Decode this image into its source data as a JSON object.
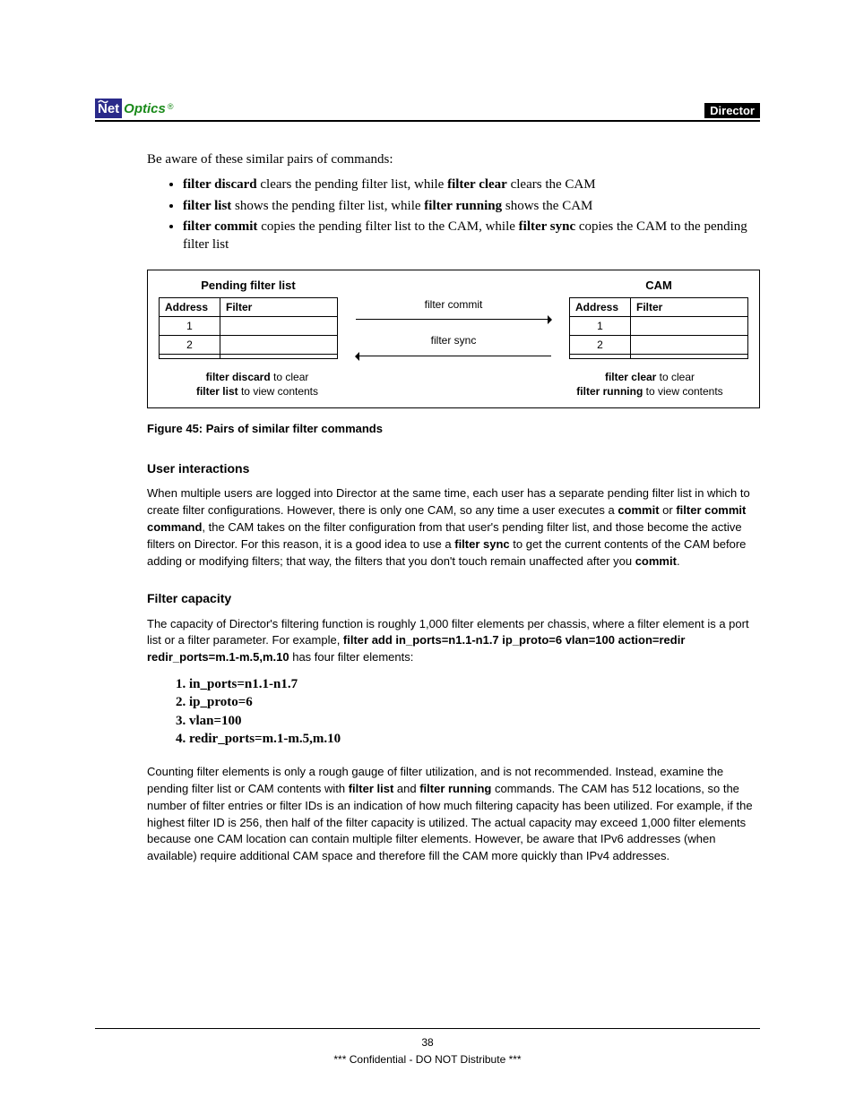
{
  "header": {
    "logo_net": "Net",
    "logo_optics": "Optics",
    "logo_reg": "®",
    "badge": "Director"
  },
  "intro": "Be aware of these similar pairs of commands:",
  "bullets": [
    {
      "b1": "filter discard",
      "t1": " clears the pending filter list, while ",
      "b2": "filter clear",
      "t2": " clears the CAM"
    },
    {
      "b1": "filter list",
      "t1": " shows the pending filter list, while ",
      "b2": "filter running",
      "t2": " shows the CAM"
    },
    {
      "b1": "filter commit",
      "t1": " copies the pending filter list to the CAM, while ",
      "b2": "filter sync",
      "t2": " copies the CAM to the pending filter list"
    }
  ],
  "figure": {
    "left_title": "Pending filter list",
    "right_title": "CAM",
    "cols": [
      "Address",
      "Filter"
    ],
    "left_rows": [
      "1",
      "2",
      ""
    ],
    "right_rows": [
      "1",
      "2",
      ""
    ],
    "arrow1": "filter commit",
    "arrow2": "filter sync",
    "under_left_b1": "filter discard",
    "under_left_t1": " to clear",
    "under_left_b2": "filter list",
    "under_left_t2": " to view contents",
    "under_right_b1": "filter clear",
    "under_right_t1": " to clear",
    "under_right_b2": "filter running",
    "under_right_t2": " to view contents"
  },
  "fig_caption": "Figure 45: Pairs of similar filter commands",
  "sec1_h": "User interactions",
  "sec1_p": {
    "t1": "When multiple users are logged into Director at the same time, each user has a separate pending filter list in which to create filter configurations. However, there is only one CAM, so any time a user executes a ",
    "b1": "commit",
    "t2": " or ",
    "b2": "filter commit command",
    "t3": ", the CAM takes on the filter configuration from that user's pending filter list, and those become the active filters on Director. For this reason, it is a good idea to use a ",
    "b3": "filter sync",
    "t4": " to get the current contents of the CAM before adding or modifying filters; that way, the filters that you don't touch remain unaffected after you ",
    "b4": "commit",
    "t5": "."
  },
  "sec2_h": "Filter capacity",
  "sec2_p1": {
    "t1": "The capacity of Director's filtering function is roughly 1,000 filter elements per chassis, where a filter element is a port list or a filter parameter. For example, ",
    "b1": "filter add in_ports=n1.1-n1.7 ip_proto=6 vlan=100 action=redir redir_ports=m.1-m.5,m.10",
    "t2": " has four filter elements:"
  },
  "numlist": [
    "1. in_ports=n1.1-n1.7",
    "2. ip_proto=6",
    "3. vlan=100",
    "4. redir_ports=m.1-m.5,m.10"
  ],
  "sec2_p2": {
    "t1": "Counting filter elements is only a rough gauge of filter utilization, and is not recommended. Instead, examine the pending filter list or CAM contents with ",
    "b1": "filter list",
    "t2": " and ",
    "b2": "filter running",
    "t3": " commands. The CAM has 512 locations, so the number of filter entries or filter IDs is an indication of how much filtering capacity has been utilized. For example, if the highest filter ID is 256, then half of the filter capacity is utilized. The actual capacity may exceed 1,000 filter elements because one CAM location can contain multiple filter elements. However, be aware that IPv6 addresses (when available) require additional CAM space and therefore fill the CAM more quickly than IPv4 addresses."
  },
  "footer": {
    "page": "38",
    "conf": "*** Confidential - DO NOT Distribute ***"
  }
}
